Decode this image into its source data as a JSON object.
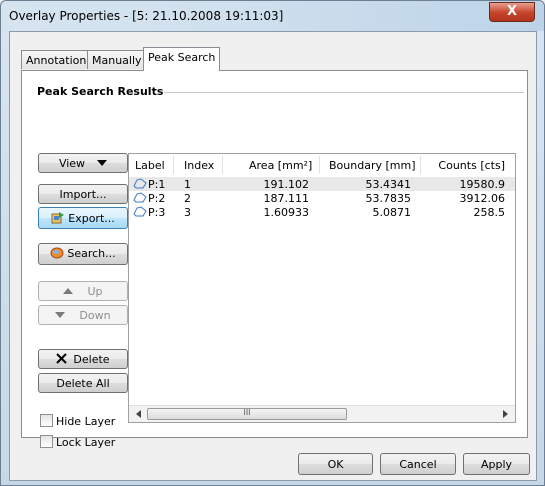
{
  "window": {
    "title": "Overlay Properties - [5: 21.10.2008 19:11:03]",
    "close_glyph": "X"
  },
  "tabs": [
    {
      "label": "Annotation",
      "active": false
    },
    {
      "label": "Manually",
      "active": false
    },
    {
      "label": "Peak Search",
      "active": true
    }
  ],
  "group": {
    "title": "Peak Search Results"
  },
  "side_buttons": {
    "view": "View",
    "import": "Import...",
    "export": "Export...",
    "search": "Search...",
    "up": "Up",
    "down": "Down",
    "delete": "Delete",
    "delete_all": "Delete All"
  },
  "checkboxes": {
    "hide_layer": {
      "label": "Hide Layer",
      "checked": false
    },
    "lock_layer": {
      "label": "Lock Layer",
      "checked": false
    }
  },
  "table": {
    "columns": [
      "Label",
      "Index",
      "Area [mm²]",
      "Boundary [mm]",
      "Counts [cts]"
    ],
    "rows": [
      {
        "label": "P:1",
        "index": "1",
        "area": "191.102",
        "boundary": "53.4341",
        "counts": "19580.9",
        "selected": true
      },
      {
        "label": "P:2",
        "index": "2",
        "area": "187.111",
        "boundary": "53.7835",
        "counts": "3912.06",
        "selected": false
      },
      {
        "label": "P:3",
        "index": "3",
        "area": "1.60933",
        "boundary": "5.0871",
        "counts": "258.5",
        "selected": false
      }
    ],
    "scroll_grip": "III"
  },
  "footer_buttons": {
    "ok": "OK",
    "cancel": "Cancel",
    "apply": "Apply"
  },
  "colors": {
    "accent": "#3c7fb1",
    "close": "#c6422a",
    "peak_icon": "#3a78c9"
  }
}
